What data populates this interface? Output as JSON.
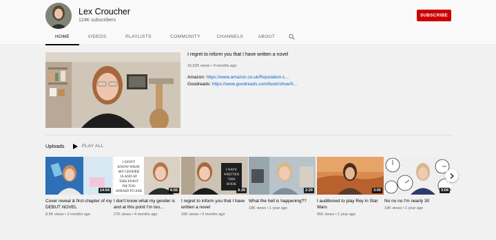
{
  "channel": {
    "name": "Lex Croucher",
    "subscribers": "124K subscribers",
    "subscribe_label": "SUBSCRIBE"
  },
  "tabs": [
    {
      "label": "HOME",
      "active": true
    },
    {
      "label": "VIDEOS",
      "active": false
    },
    {
      "label": "PLAYLISTS",
      "active": false
    },
    {
      "label": "COMMUNITY",
      "active": false
    },
    {
      "label": "CHANNELS",
      "active": false
    },
    {
      "label": "ABOUT",
      "active": false
    }
  ],
  "search_icon": "search-icon",
  "featured": {
    "title": "I regret to inform you that I have written a novel",
    "meta": "16,635 views • 9 months ago",
    "amazon_label": "Amazon:",
    "amazon_link": "https://www.amazon.co.uk/Reputation-L...",
    "goodreads_label": "Goodreads:",
    "goodreads_link": "https://www.goodreads.com/book/show/5..."
  },
  "uploads": {
    "title": "Uploads",
    "play_all": "PLAY ALL",
    "videos": [
      {
        "title": "Cover reveal & first chapter of my DEBUT NOVEL",
        "meta": "8.5K views • 2 months ago",
        "duration": "14:54"
      },
      {
        "title": "I don't know what my gender is and at this point I'm too...",
        "meta": "27K views • 4 months ago",
        "duration": "6:55"
      },
      {
        "title": "I regret to inform you that I have written a novel",
        "meta": "16K views • 9 months ago",
        "duration": "9:29"
      },
      {
        "title": "What the hell is happening??",
        "meta": "18K views • 1 year ago",
        "duration": "2:29"
      },
      {
        "title": "I auditioned to play Rey in Star Wars",
        "meta": "95K views • 1 year ago",
        "duration": "3:00"
      },
      {
        "title": "No no no I'm nearly 30",
        "meta": "19K views • 1 year ago",
        "duration": "3:04"
      }
    ]
  },
  "thumb_text": {
    "v2": [
      "I DON'T",
      "KNOW WHAT",
      "MY GENDER",
      "IS AND AT",
      "THIS POINT",
      "I'M TOO",
      "AFRAID TO ASK"
    ],
    "v3": [
      "I HAVE",
      "WRITTEN",
      "THIS",
      "BOOK"
    ]
  },
  "colors": {
    "subscribe": "#cc0000",
    "link": "#065fd4",
    "background": "#f9f9f9",
    "content_background": "#f1f1f1"
  }
}
